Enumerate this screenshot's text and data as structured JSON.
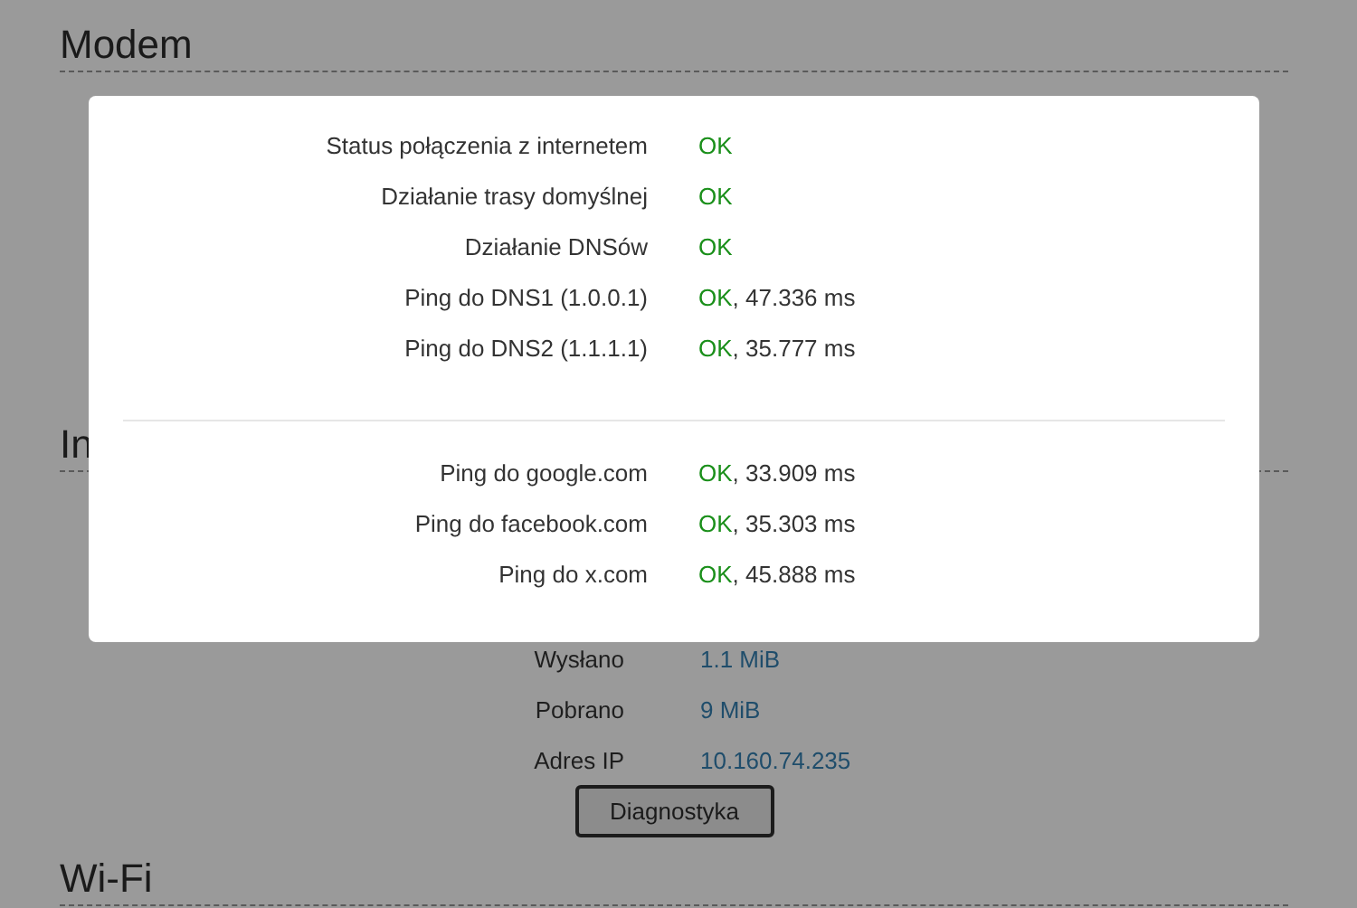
{
  "page": {
    "sections": [
      {
        "title": "Modem"
      },
      {
        "title": "In"
      }
    ],
    "details": [
      {
        "label": "Wysłano",
        "value": "1.1 MiB"
      },
      {
        "label": "Pobrano",
        "value": "9 MiB"
      },
      {
        "label": "Adres IP",
        "value": "10.160.74.235"
      }
    ],
    "button": "Diagnostyka",
    "next_section": "Wi-Fi"
  },
  "dialog": {
    "groups": [
      [
        {
          "label": "Status połączenia z internetem",
          "status": "OK"
        },
        {
          "label": "Działanie trasy domyślnej",
          "status": "OK"
        },
        {
          "label": "Działanie DNSów",
          "status": "OK"
        },
        {
          "label": "Ping do DNS1 (1.0.0.1)",
          "status": "OK",
          "detail": ", 47.336 ms"
        },
        {
          "label": "Ping do DNS2 (1.1.1.1)",
          "status": "OK",
          "detail": ", 35.777 ms"
        }
      ],
      [
        {
          "label": "Ping do google.com",
          "status": "OK",
          "detail": ", 33.909 ms"
        },
        {
          "label": "Ping do facebook.com",
          "status": "OK",
          "detail": ", 35.303 ms"
        },
        {
          "label": "Ping do x.com",
          "status": "OK",
          "detail": ", 45.888 ms"
        }
      ]
    ]
  }
}
